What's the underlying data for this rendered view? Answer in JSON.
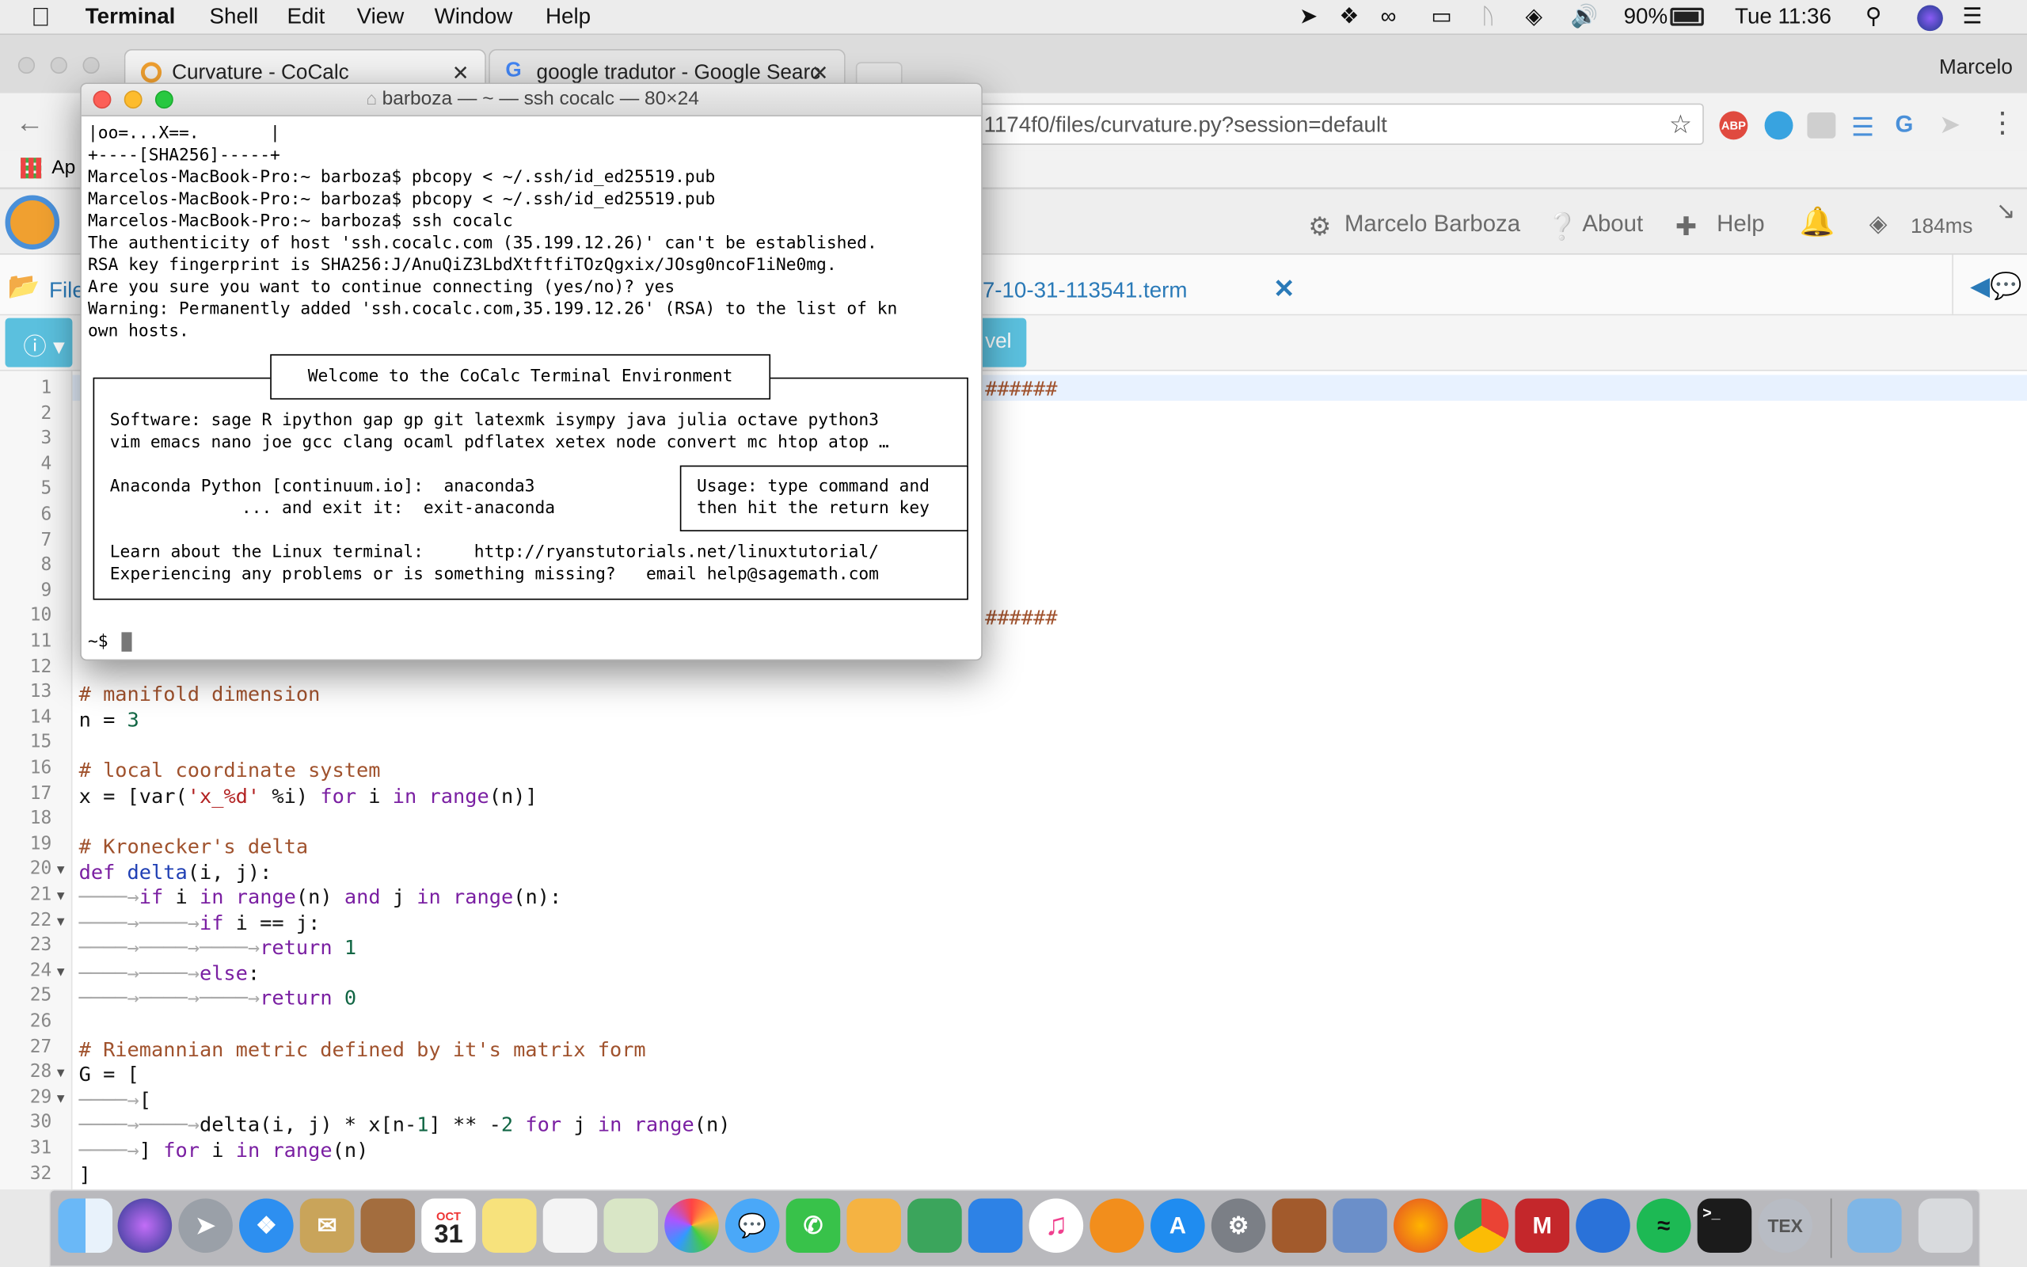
{
  "menubar": {
    "app": "Terminal",
    "items": [
      "Shell",
      "Edit",
      "View",
      "Window",
      "Help"
    ],
    "battery": "90%",
    "clock": "Tue 11:36"
  },
  "chrome": {
    "tabs": [
      {
        "label": "Curvature - CoCalc"
      },
      {
        "label": "google tradutor - Google Searc"
      }
    ],
    "profile": "Marcelo",
    "url": "1174f0/files/curvature.py?session=default",
    "bookmark": "Ap"
  },
  "cocalc": {
    "user": "Marcelo Barboza",
    "about": "About",
    "help": "Help",
    "ping": "184ms",
    "files": "File",
    "filetab": "7-10-31-113541.term",
    "tool_partial": "vel"
  },
  "terminal": {
    "title": "barboza — ~ — ssh cocalc — 80×24",
    "lines": [
      "|oo=...X==.       |",
      "+----[SHA256]-----+",
      "Marcelos-MacBook-Pro:~ barboza$ pbcopy < ~/.ssh/id_ed25519.pub",
      "Marcelos-MacBook-Pro:~ barboza$ pbcopy < ~/.ssh/id_ed25519.pub",
      "Marcelos-MacBook-Pro:~ barboza$ ssh cocalc",
      "The authenticity of host 'ssh.cocalc.com (35.199.12.26)' can't be established.",
      "RSA key fingerprint is SHA256:J/AnuQiZ3LbdXtftfiTOzQgxix/JOsg0ncoF1iNe0mg.",
      "Are you sure you want to continue connecting (yes/no)? yes",
      "Warning: Permanently added 'ssh.cocalc.com,35.199.12.26' (RSA) to the list of kn",
      "own hosts."
    ],
    "welcome": "Welcome to the CoCalc Terminal Environment",
    "software1": "Software: sage R ipython gap gp git latexmk isympy java julia octave python3",
    "software2": "vim emacs nano joe gcc clang ocaml pdflatex xetex node convert mc htop atop …",
    "anaconda1": "Anaconda Python [continuum.io]:  anaconda3",
    "anaconda2": "             ... and exit it:  exit-anaconda",
    "usage1": "Usage: type command and",
    "usage2": "then hit the return key",
    "learn": "Learn about the Linux terminal:     http://ryanstutorials.net/linuxtutorial/",
    "problems": "Experiencing any problems or is something missing?   email help@sagemath.com",
    "prompt": "~$"
  },
  "editor": {
    "line_numbers": [
      "1",
      "2",
      "3",
      "4",
      "5",
      "6",
      "7",
      "8",
      "9",
      "10",
      "11",
      "12",
      "13",
      "14",
      "15",
      "16",
      "17",
      "18",
      "19",
      "20",
      "21",
      "22",
      "23",
      "24",
      "25",
      "26",
      "27",
      "28",
      "29",
      "30",
      "31",
      "32"
    ],
    "hash_run": "######"
  },
  "dock": {
    "calendar_month": "OCT",
    "calendar_day": "31"
  }
}
